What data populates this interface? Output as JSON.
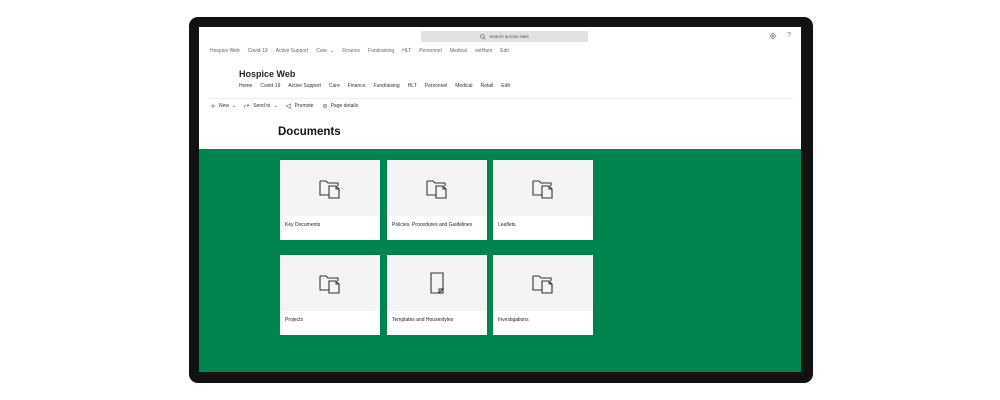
{
  "suite": {
    "search_placeholder": "Search across sites",
    "settings_icon": "gear-icon",
    "help_label": "?"
  },
  "hubnav": {
    "items": [
      "Hospice Web",
      "Covid-19",
      "Active Support",
      "Care",
      "Finance",
      "Fundraising",
      "HLT",
      "Personnel",
      "Medical",
      "vetHam",
      "Edit"
    ]
  },
  "site": {
    "title": "Hospice Web",
    "nav": [
      "Home",
      "Covid-19",
      "Active Support",
      "Care",
      "Finance",
      "Fundraising",
      "HLT",
      "Personnel",
      "Medical",
      "Retail",
      "Edit"
    ]
  },
  "commands": {
    "new_label": "New",
    "send_label": "Send to",
    "promote_label": "Promote",
    "details_label": "Page details"
  },
  "main": {
    "title": "Documents",
    "accent_color": "#00844f",
    "tiles": [
      {
        "label": "Key Documents",
        "icon": "folder-icon"
      },
      {
        "label": "Policies, Procedures and Guidelines",
        "icon": "folder-icon"
      },
      {
        "label": "Leaflets",
        "icon": "folder-icon"
      },
      {
        "label": "Projects",
        "icon": "folder-icon"
      },
      {
        "label": "Templates and Housestyles",
        "icon": "document-icon"
      },
      {
        "label": "Investigations",
        "icon": "folder-icon"
      }
    ]
  }
}
